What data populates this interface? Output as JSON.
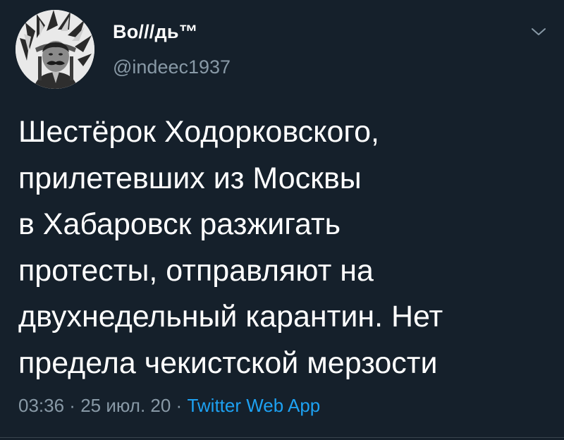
{
  "author": {
    "display_name": "Во///дь™",
    "handle": "@indeec1937",
    "avatar_icon": "avatar-portrait-headdress"
  },
  "menu": {
    "icon": "chevron-down-icon"
  },
  "tweet": {
    "lines": [
      "Шестёрок Ходорковского,",
      "прилетевших из Москвы",
      "в Хабаровск разжигать",
      "протесты, отправляют на",
      "двухнедельный карантин. Нет",
      "предела чекистской мерзости"
    ]
  },
  "meta": {
    "time": "03:36",
    "separator": " · ",
    "date": "25 июл. 20",
    "source": "Twitter Web App"
  },
  "colors": {
    "background": "#15202b",
    "text": "#ffffff",
    "secondary": "#8899a6",
    "accent": "#1da1f2"
  }
}
